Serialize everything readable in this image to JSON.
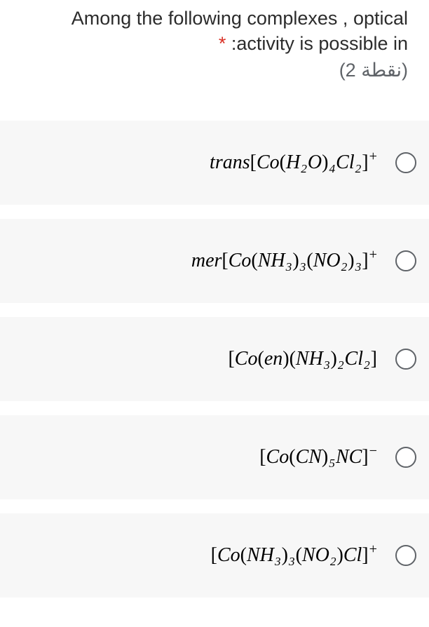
{
  "question": {
    "line1": "Among the following complexes , optical",
    "line2": ":activity is possible in",
    "required_marker": "*",
    "points_text": "(2 نقطة)"
  },
  "options": [
    {
      "formula_html": "trans<span class='p-l'>[</span>Co<span class='p-l'>(</span>H<sub>2</sub>O<span class='p-r'>)</span><sub>4</sub>Cl<sub>2</sub><span class='p-r'>]</span><sup>+</sup>"
    },
    {
      "formula_html": "mer<span class='p-l'>[</span>Co<span class='p-l'>(</span>NH<sub>3</sub><span class='p-r'>)</span><sub>3</sub><span class='p-l'>(</span>NO<sub>2</sub><span class='p-r'>)</span><sub>3</sub><span class='p-r'>]</span><sup>+</sup>"
    },
    {
      "formula_html": "<span class='p-l'>[</span>Co<span class='p-l'>(</span>en<span class='p-r'>)</span><span class='p-l'>(</span>NH<sub>3</sub><span class='p-r'>)</span><sub>2</sub>Cl<sub>2</sub><span class='p-r'>]</span>"
    },
    {
      "formula_html": "<span class='p-l'>[</span>Co<span class='p-l'>(</span>CN<span class='p-r'>)</span><sub>5</sub>NC<span class='p-r'>]</span><sup>−</sup>"
    },
    {
      "formula_html": "<span class='p-l'>[</span>Co<span class='p-l'>(</span>NH<sub>3</sub><span class='p-r'>)</span><sub>3</sub><span class='p-l'>(</span>NO<sub>2</sub><span class='p-r'>)</span>Cl<span class='p-r'>]</span><sup>+</sup>"
    }
  ]
}
